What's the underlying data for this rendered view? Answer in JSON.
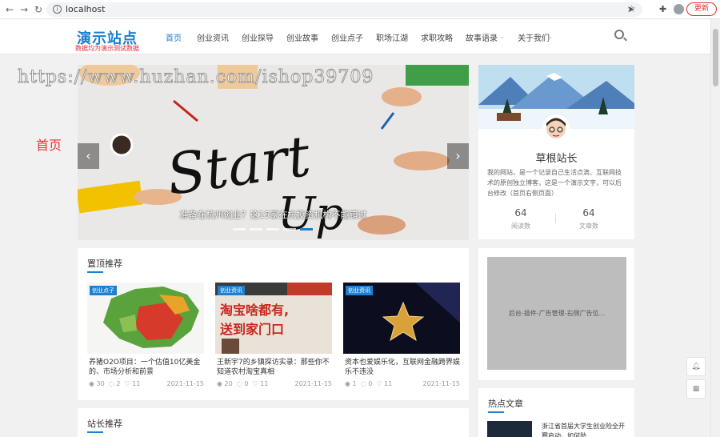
{
  "browser": {
    "url": "localhost",
    "update_label": "更新"
  },
  "site": {
    "logo_title": "演示站点",
    "logo_subtitle": "数据均为演示测试数据",
    "menu": [
      {
        "label": "首页",
        "active": true
      },
      {
        "label": "创业资讯"
      },
      {
        "label": "创业探导"
      },
      {
        "label": "创业故事"
      },
      {
        "label": "创业点子"
      },
      {
        "label": "职场江湖"
      },
      {
        "label": "求职攻略"
      },
      {
        "label": "故事语录"
      },
      {
        "label": "关于我们"
      }
    ]
  },
  "watermark": "https://www.huzhan.com/ishop39709",
  "side_label": "首页",
  "slider": {
    "caption": "准备在杭州创业？这15家在杭投资机构不能错过",
    "slide_text": "Start Up",
    "dot_count": 5,
    "active_dot": 4
  },
  "profile": {
    "name": "草根站长",
    "bio": "我的网站，是一个记录自己生活点滴、互联网技术的原创独立博客，这是一个演示文字，可以后台修改（首页右侧页面）",
    "stats": [
      {
        "value": "64",
        "label": "阅读数"
      },
      {
        "value": "64",
        "label": "文章数"
      }
    ]
  },
  "featured": {
    "title": "置顶推荐",
    "cards": [
      {
        "tag": "创业点子",
        "title": "养猪O2O项目：一个估值10亿美金的、市场分析和前景",
        "views": "30",
        "comments": "2",
        "likes": "11",
        "date": "2021-11-15"
      },
      {
        "tag": "创业资讯",
        "title": "王新宇7的乡镇探访实录：那些你不知道农村淘宝真相",
        "views": "20",
        "comments": "0",
        "likes": "11",
        "date": "2021-11-15"
      },
      {
        "tag": "创业资讯",
        "title": "资本也爱娱乐化，互联网金融跨界娱乐不违没",
        "views": "1",
        "comments": "0",
        "likes": "11",
        "date": "2021-11-15"
      }
    ]
  },
  "ad": {
    "text": "后台-插件-广告管理-右侧广告位..."
  },
  "hot": {
    "title": "热点文章",
    "first_item": "浙江省首届大学生创业险全开赛启动，如何助..."
  },
  "station": {
    "title": "站长推荐"
  },
  "colors": {
    "accent": "#1c7fd0",
    "side_label": "#e33333"
  }
}
